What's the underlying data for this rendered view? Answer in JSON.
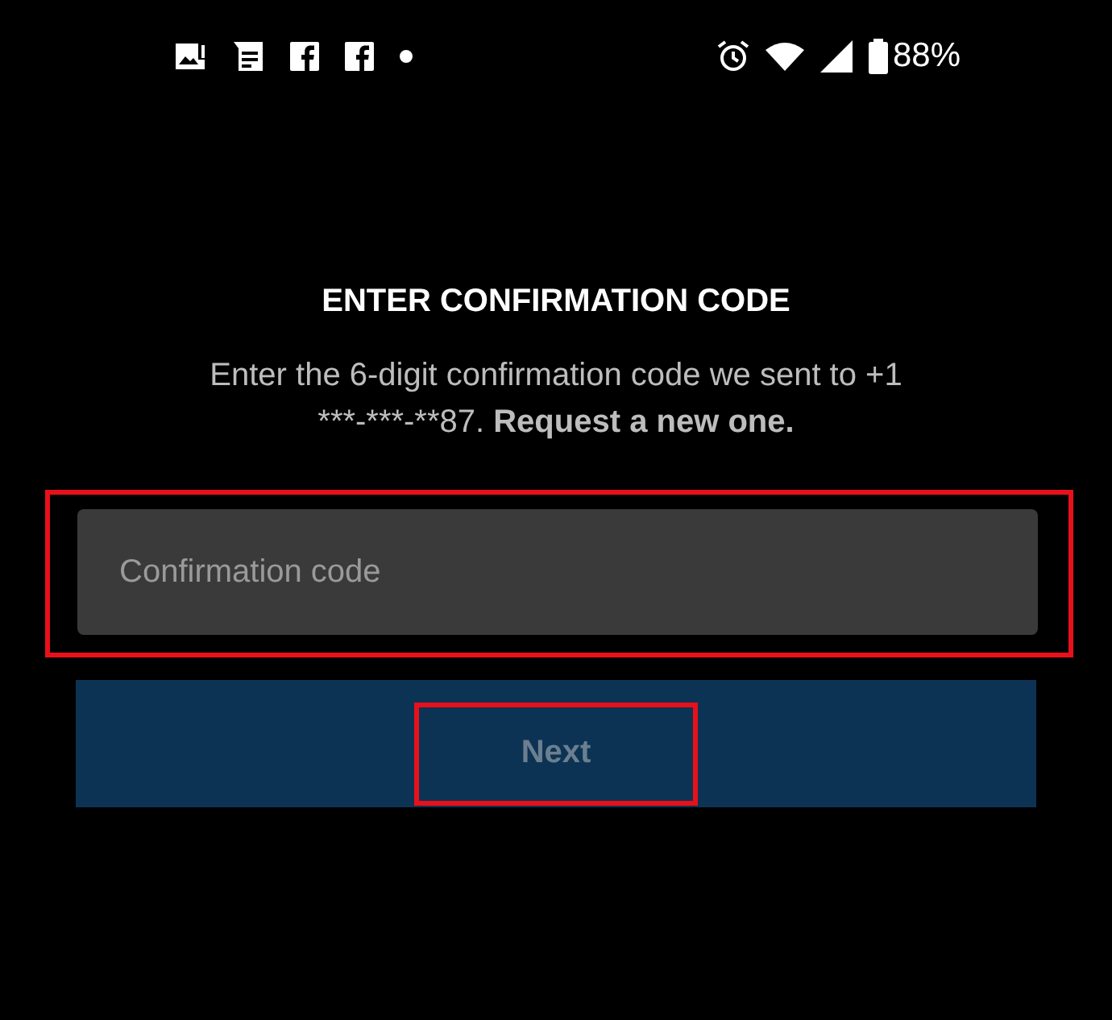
{
  "status_bar": {
    "left_icons": [
      {
        "kind": "picture"
      },
      {
        "kind": "note"
      },
      {
        "kind": "facebook"
      },
      {
        "kind": "facebook"
      },
      {
        "kind": "dot"
      }
    ],
    "battery": "88%"
  },
  "title": "ENTER CONFIRMATION CODE",
  "description": "Enter the 6-digit confirmation code we sent to +1 ***-***-**87.",
  "request_link": "Request a new one.",
  "code_field": {
    "placeholder": "Confirmation code",
    "highlighted": true
  },
  "next_button": {
    "label": "Next",
    "disabled": true,
    "highlighted": true
  }
}
